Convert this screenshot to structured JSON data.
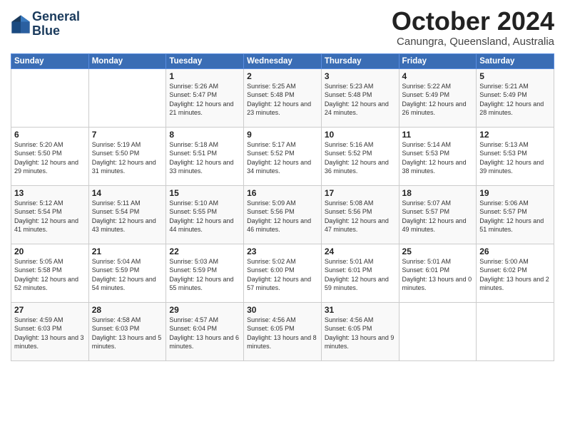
{
  "logo": {
    "line1": "General",
    "line2": "Blue"
  },
  "title": "October 2024",
  "subtitle": "Canungra, Queensland, Australia",
  "weekdays": [
    "Sunday",
    "Monday",
    "Tuesday",
    "Wednesday",
    "Thursday",
    "Friday",
    "Saturday"
  ],
  "weeks": [
    [
      {
        "day": "",
        "sunrise": "",
        "sunset": "",
        "daylight": ""
      },
      {
        "day": "",
        "sunrise": "",
        "sunset": "",
        "daylight": ""
      },
      {
        "day": "1",
        "sunrise": "Sunrise: 5:26 AM",
        "sunset": "Sunset: 5:47 PM",
        "daylight": "Daylight: 12 hours and 21 minutes."
      },
      {
        "day": "2",
        "sunrise": "Sunrise: 5:25 AM",
        "sunset": "Sunset: 5:48 PM",
        "daylight": "Daylight: 12 hours and 23 minutes."
      },
      {
        "day": "3",
        "sunrise": "Sunrise: 5:23 AM",
        "sunset": "Sunset: 5:48 PM",
        "daylight": "Daylight: 12 hours and 24 minutes."
      },
      {
        "day": "4",
        "sunrise": "Sunrise: 5:22 AM",
        "sunset": "Sunset: 5:49 PM",
        "daylight": "Daylight: 12 hours and 26 minutes."
      },
      {
        "day": "5",
        "sunrise": "Sunrise: 5:21 AM",
        "sunset": "Sunset: 5:49 PM",
        "daylight": "Daylight: 12 hours and 28 minutes."
      }
    ],
    [
      {
        "day": "6",
        "sunrise": "Sunrise: 5:20 AM",
        "sunset": "Sunset: 5:50 PM",
        "daylight": "Daylight: 12 hours and 29 minutes."
      },
      {
        "day": "7",
        "sunrise": "Sunrise: 5:19 AM",
        "sunset": "Sunset: 5:50 PM",
        "daylight": "Daylight: 12 hours and 31 minutes."
      },
      {
        "day": "8",
        "sunrise": "Sunrise: 5:18 AM",
        "sunset": "Sunset: 5:51 PM",
        "daylight": "Daylight: 12 hours and 33 minutes."
      },
      {
        "day": "9",
        "sunrise": "Sunrise: 5:17 AM",
        "sunset": "Sunset: 5:52 PM",
        "daylight": "Daylight: 12 hours and 34 minutes."
      },
      {
        "day": "10",
        "sunrise": "Sunrise: 5:16 AM",
        "sunset": "Sunset: 5:52 PM",
        "daylight": "Daylight: 12 hours and 36 minutes."
      },
      {
        "day": "11",
        "sunrise": "Sunrise: 5:14 AM",
        "sunset": "Sunset: 5:53 PM",
        "daylight": "Daylight: 12 hours and 38 minutes."
      },
      {
        "day": "12",
        "sunrise": "Sunrise: 5:13 AM",
        "sunset": "Sunset: 5:53 PM",
        "daylight": "Daylight: 12 hours and 39 minutes."
      }
    ],
    [
      {
        "day": "13",
        "sunrise": "Sunrise: 5:12 AM",
        "sunset": "Sunset: 5:54 PM",
        "daylight": "Daylight: 12 hours and 41 minutes."
      },
      {
        "day": "14",
        "sunrise": "Sunrise: 5:11 AM",
        "sunset": "Sunset: 5:54 PM",
        "daylight": "Daylight: 12 hours and 43 minutes."
      },
      {
        "day": "15",
        "sunrise": "Sunrise: 5:10 AM",
        "sunset": "Sunset: 5:55 PM",
        "daylight": "Daylight: 12 hours and 44 minutes."
      },
      {
        "day": "16",
        "sunrise": "Sunrise: 5:09 AM",
        "sunset": "Sunset: 5:56 PM",
        "daylight": "Daylight: 12 hours and 46 minutes."
      },
      {
        "day": "17",
        "sunrise": "Sunrise: 5:08 AM",
        "sunset": "Sunset: 5:56 PM",
        "daylight": "Daylight: 12 hours and 47 minutes."
      },
      {
        "day": "18",
        "sunrise": "Sunrise: 5:07 AM",
        "sunset": "Sunset: 5:57 PM",
        "daylight": "Daylight: 12 hours and 49 minutes."
      },
      {
        "day": "19",
        "sunrise": "Sunrise: 5:06 AM",
        "sunset": "Sunset: 5:57 PM",
        "daylight": "Daylight: 12 hours and 51 minutes."
      }
    ],
    [
      {
        "day": "20",
        "sunrise": "Sunrise: 5:05 AM",
        "sunset": "Sunset: 5:58 PM",
        "daylight": "Daylight: 12 hours and 52 minutes."
      },
      {
        "day": "21",
        "sunrise": "Sunrise: 5:04 AM",
        "sunset": "Sunset: 5:59 PM",
        "daylight": "Daylight: 12 hours and 54 minutes."
      },
      {
        "day": "22",
        "sunrise": "Sunrise: 5:03 AM",
        "sunset": "Sunset: 5:59 PM",
        "daylight": "Daylight: 12 hours and 55 minutes."
      },
      {
        "day": "23",
        "sunrise": "Sunrise: 5:02 AM",
        "sunset": "Sunset: 6:00 PM",
        "daylight": "Daylight: 12 hours and 57 minutes."
      },
      {
        "day": "24",
        "sunrise": "Sunrise: 5:01 AM",
        "sunset": "Sunset: 6:01 PM",
        "daylight": "Daylight: 12 hours and 59 minutes."
      },
      {
        "day": "25",
        "sunrise": "Sunrise: 5:01 AM",
        "sunset": "Sunset: 6:01 PM",
        "daylight": "Daylight: 13 hours and 0 minutes."
      },
      {
        "day": "26",
        "sunrise": "Sunrise: 5:00 AM",
        "sunset": "Sunset: 6:02 PM",
        "daylight": "Daylight: 13 hours and 2 minutes."
      }
    ],
    [
      {
        "day": "27",
        "sunrise": "Sunrise: 4:59 AM",
        "sunset": "Sunset: 6:03 PM",
        "daylight": "Daylight: 13 hours and 3 minutes."
      },
      {
        "day": "28",
        "sunrise": "Sunrise: 4:58 AM",
        "sunset": "Sunset: 6:03 PM",
        "daylight": "Daylight: 13 hours and 5 minutes."
      },
      {
        "day": "29",
        "sunrise": "Sunrise: 4:57 AM",
        "sunset": "Sunset: 6:04 PM",
        "daylight": "Daylight: 13 hours and 6 minutes."
      },
      {
        "day": "30",
        "sunrise": "Sunrise: 4:56 AM",
        "sunset": "Sunset: 6:05 PM",
        "daylight": "Daylight: 13 hours and 8 minutes."
      },
      {
        "day": "31",
        "sunrise": "Sunrise: 4:56 AM",
        "sunset": "Sunset: 6:05 PM",
        "daylight": "Daylight: 13 hours and 9 minutes."
      },
      {
        "day": "",
        "sunrise": "",
        "sunset": "",
        "daylight": ""
      },
      {
        "day": "",
        "sunrise": "",
        "sunset": "",
        "daylight": ""
      }
    ]
  ]
}
